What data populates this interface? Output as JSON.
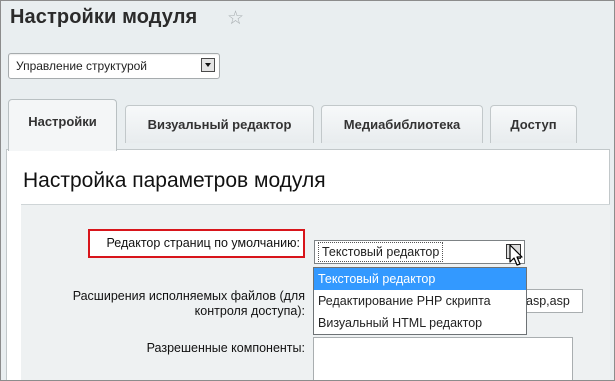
{
  "page": {
    "title": "Настройки модуля"
  },
  "header": {
    "star_icon": "star-icon"
  },
  "module_select": {
    "value": "Управление структурой"
  },
  "tabs": [
    {
      "label": "Настройки",
      "active": true
    },
    {
      "label": "Визуальный редактор",
      "active": false
    },
    {
      "label": "Медиабиблиотека",
      "active": false
    },
    {
      "label": "Доступ",
      "active": false
    }
  ],
  "panel": {
    "title": "Настройка параметров модуля"
  },
  "form": {
    "default_editor_label": "Редактор страниц по умолчанию:",
    "default_editor_value": "Текстовый редактор",
    "default_editor_options": [
      "Текстовый редактор",
      "Редактирование PHP скрипта",
      "Визуальный HTML редактор"
    ],
    "extensions_label_line1": "Расширения исполняемых файлов (для",
    "extensions_label_line2": "контроля доступа):",
    "extensions_value": "asp,asp",
    "allowed_components_label": "Разрешенные компоненты:"
  },
  "colors": {
    "highlight_border": "#d8151b",
    "selected_option": "#3399ff"
  }
}
